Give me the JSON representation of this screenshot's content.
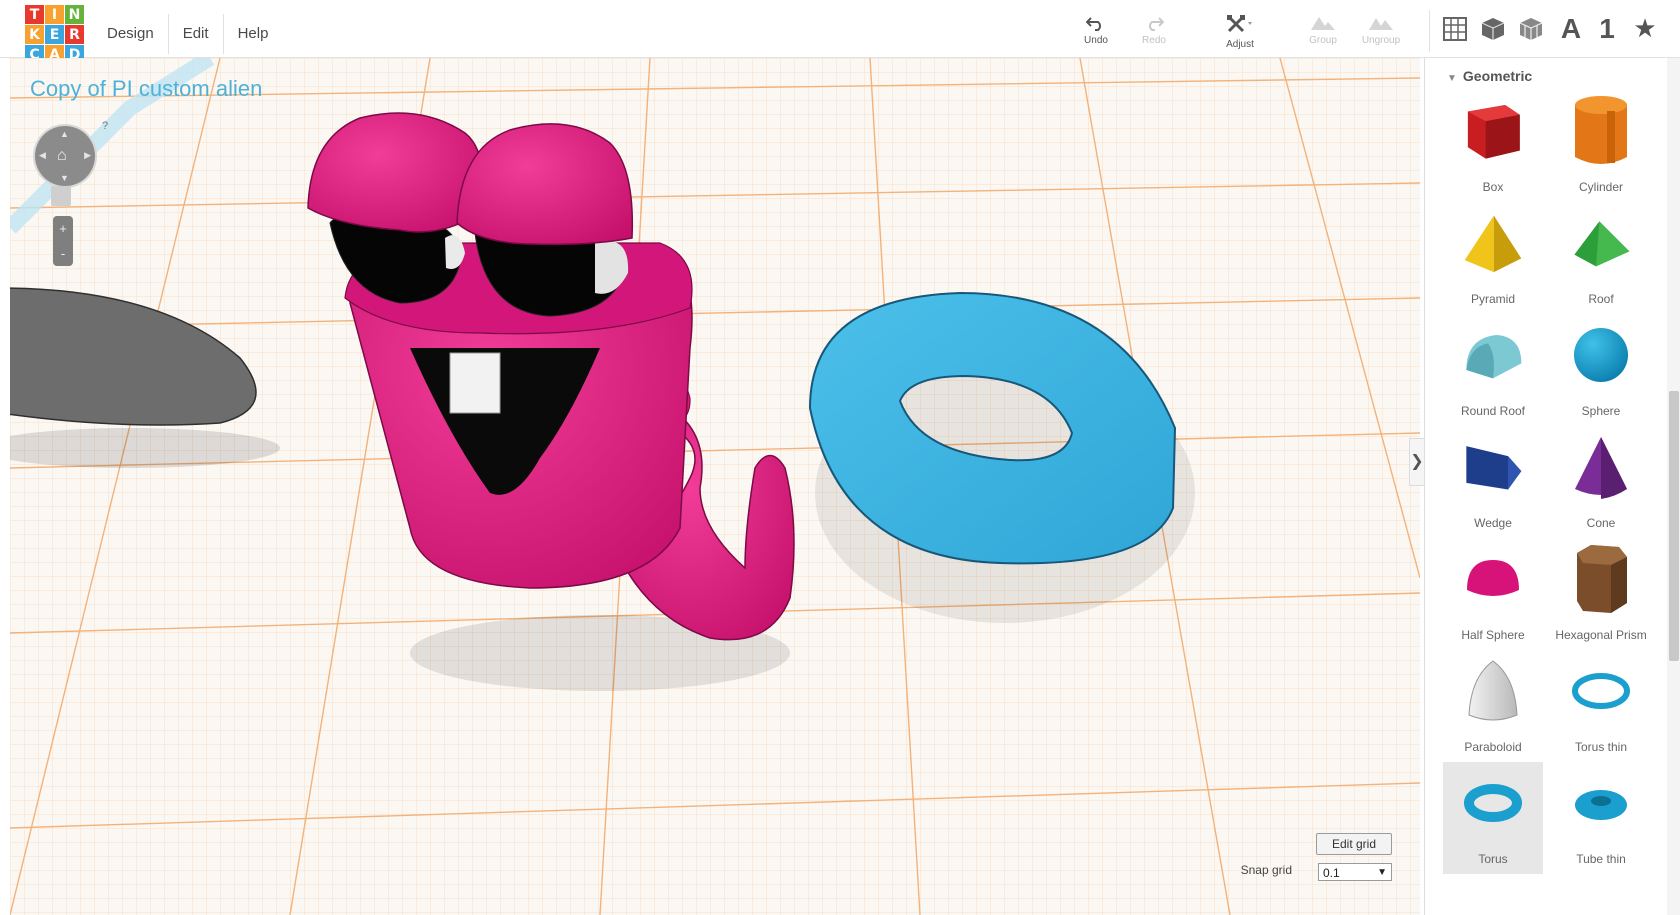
{
  "logo": {
    "letters": [
      "T",
      "I",
      "N",
      "K",
      "E",
      "R",
      "C",
      "A",
      "D"
    ],
    "colors": [
      "#e8392f",
      "#f9a12e",
      "#65b33b",
      "#f9a12e",
      "#3aa6de",
      "#e8392f",
      "#3aa6de",
      "#f9a12e",
      "#3aa6de"
    ]
  },
  "menu": [
    {
      "label": "Design"
    },
    {
      "label": "Edit"
    },
    {
      "label": "Help"
    }
  ],
  "toolbar": {
    "undo_label": "Undo",
    "redo_label": "Redo",
    "adjust_label": "Adjust",
    "group_label": "Group",
    "ungroup_label": "Ungroup",
    "text_tool": "A",
    "number_tool": "1",
    "star_tool": "★"
  },
  "viewport": {
    "design_title": "Copy of PI custom alien",
    "nav_help": "?",
    "zoom_in": "+",
    "zoom_out": "-",
    "edit_grid_label": "Edit grid",
    "snap_grid_label": "Snap grid",
    "snap_grid_value": "0.1",
    "collapse_glyph": "❯"
  },
  "sidebar": {
    "section_title": "Geometric",
    "shapes": [
      {
        "label": "Box"
      },
      {
        "label": "Cylinder"
      },
      {
        "label": "Pyramid"
      },
      {
        "label": "Roof"
      },
      {
        "label": "Round Roof"
      },
      {
        "label": "Sphere"
      },
      {
        "label": "Wedge"
      },
      {
        "label": "Cone"
      },
      {
        "label": "Half Sphere"
      },
      {
        "label": "Hexagonal Prism"
      },
      {
        "label": "Paraboloid"
      },
      {
        "label": "Torus thin"
      },
      {
        "label": "Torus"
      },
      {
        "label": "Tube thin"
      }
    ]
  },
  "colors": {
    "accent": "#4eb2d8",
    "alien_pink": "#e0197a",
    "ring_blue": "#3ab3e0",
    "grid_orange": "#f3b27a"
  }
}
